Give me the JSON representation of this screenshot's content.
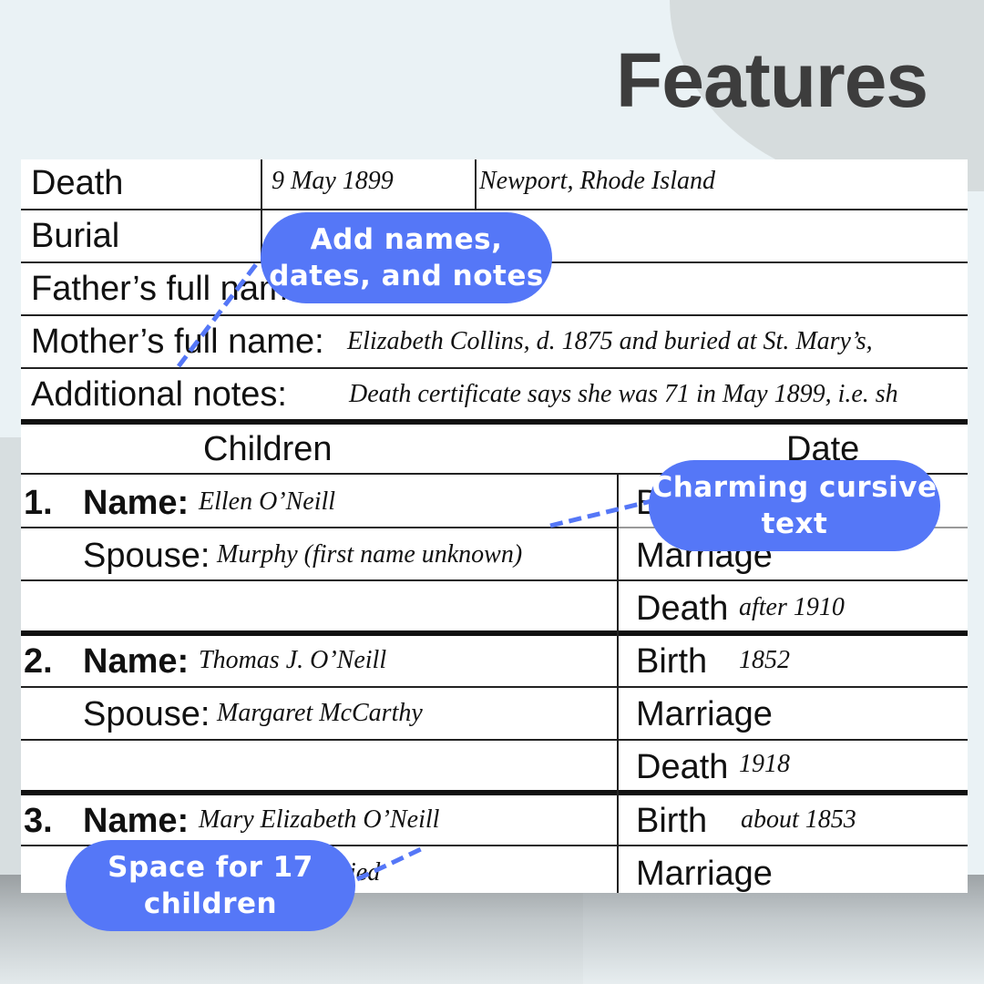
{
  "title": "Features",
  "record": {
    "death_label": "Death",
    "death_date": "9 May 1899",
    "death_place": "Newport, Rhode Island",
    "burial_label": "Burial",
    "father_label": "Father’s full name",
    "mother_label": "Mother’s full name:",
    "mother_value": "Elizabeth Collins, d. 1875 and buried at St. Mary’s,",
    "notes_label": "Additional notes:",
    "notes_value": "Death certificate says she was 71 in May 1899, i.e. sh"
  },
  "children_header": "Children",
  "date_header": "Date",
  "children": [
    {
      "num": "1.",
      "name_label": "Name:",
      "name": "Ellen O’Neill",
      "spouse_label": "Spouse:",
      "spouse": "Murphy (first name unknown)",
      "birth_label": "B",
      "birth": "",
      "marriage_label": "Marriage",
      "death_label": "Death",
      "death": "after 1910"
    },
    {
      "num": "2.",
      "name_label": "Name:",
      "name": "Thomas J. O’Neill",
      "spouse_label": "Spouse:",
      "spouse": "Margaret McCarthy",
      "birth_label": "Birth",
      "birth": "1852",
      "marriage_label": "Marriage",
      "death_label": "Death",
      "death": "1918"
    },
    {
      "num": "3.",
      "name_label": "Name:",
      "name": "Mary Elizabeth O’Neill",
      "spouse_partial": "ied",
      "birth_label": "Birth",
      "birth": "about 1853",
      "marriage_label": "Marriage"
    }
  ],
  "callouts": {
    "names": "Add names, dates, and notes",
    "cursive": "Charming cursive text",
    "space": "Space for 17 children"
  },
  "colors": {
    "accent": "#5577f7",
    "background": "#eaf2f5",
    "title": "#3d3d3d"
  }
}
